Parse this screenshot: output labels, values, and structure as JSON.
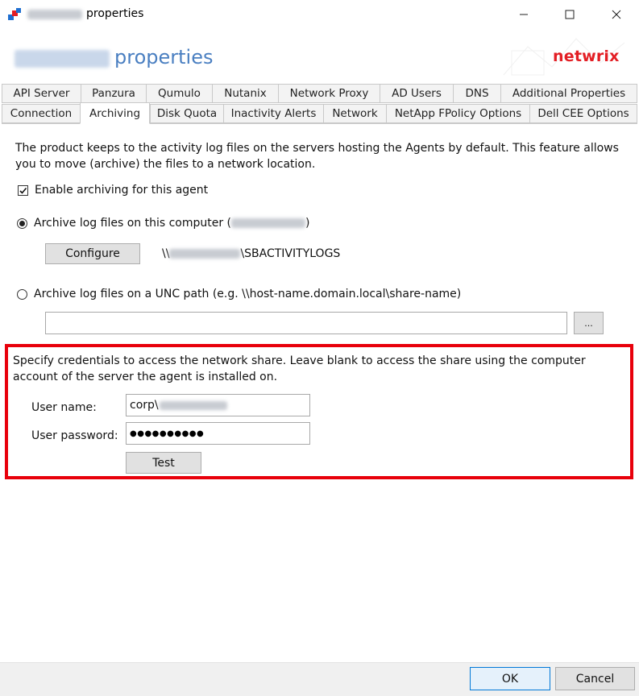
{
  "window": {
    "title": "properties",
    "controls": [
      "minimize-icon",
      "maximize-icon",
      "close-icon"
    ]
  },
  "header": {
    "title": "properties",
    "brand": "netwrix"
  },
  "tabs": {
    "row1": [
      "API Server",
      "Panzura",
      "Qumulo",
      "Nutanix",
      "Network Proxy",
      "AD Users",
      "DNS",
      "Additional Properties"
    ],
    "row2": [
      "Connection",
      "Archiving",
      "Disk Quota",
      "Inactivity Alerts",
      "Network",
      "NetApp FPolicy Options",
      "Dell CEE Options"
    ],
    "active": "Archiving"
  },
  "archiving": {
    "description": "The product keeps to the activity log files on the servers hosting the Agents by default. This feature allows you to move (archive) the files to a network location.",
    "enable_label": "Enable archiving for this agent",
    "enable_checked": true,
    "local_option_label_prefix": "Archive log files on this computer (",
    "local_option_label_suffix": ")",
    "local_option_selected": true,
    "configure_button": "Configure",
    "path_prefix": "\\\\",
    "path_suffix": "\\SBACTIVITYLOGS",
    "unc_option_label": "Archive log files on a UNC path (e.g. \\\\host-name.domain.local\\share-name)",
    "unc_option_selected": false,
    "unc_path_value": "",
    "browse_button": "..."
  },
  "credentials": {
    "description": "Specify credentials to access the network share. Leave blank to access the share using the computer account of the server the agent is installed on.",
    "username_label": "User name:",
    "username_value": "corp\\",
    "password_label": "User password:",
    "password_value": "●●●●●●●●●●",
    "test_button": "Test",
    "highlight_color": "#e8000b"
  },
  "footer": {
    "ok_button": "OK",
    "cancel_button": "Cancel"
  }
}
